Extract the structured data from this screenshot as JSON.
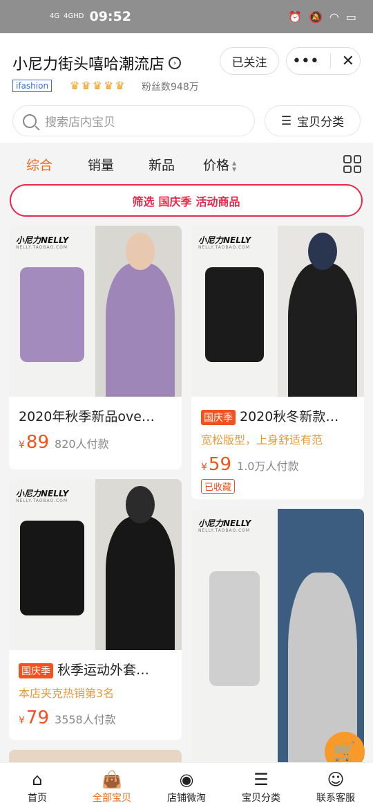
{
  "status_bar": {
    "signal1": "4G",
    "signal2": "4GHD",
    "time": "09:52"
  },
  "shop": {
    "name": "小尼力街头嘻哈潮流店",
    "follow_label": "已关注",
    "badge": "ifashion",
    "fans": "粉丝数948万",
    "crown_count": 5
  },
  "search": {
    "placeholder": "搜索店内宝贝",
    "category_label": "宝贝分类"
  },
  "sort_tabs": {
    "overall": "综合",
    "sales": "销量",
    "new": "新品",
    "price": "价格"
  },
  "filter_banner": {
    "prefix": "筛选",
    "highlight": "国庆季",
    "suffix": "活动商品"
  },
  "products": [
    {
      "brand": "小尼力NELLY",
      "brand_sub": "NELLY.TAOBAO.COM",
      "title": "2020年秋季新品ove…",
      "price": "89",
      "sold": "820人付款"
    },
    {
      "brand": "小尼力NELLY",
      "brand_sub": "NELLY.TAOBAO.COM",
      "tag": "国庆季",
      "title": "2020秋冬新款…",
      "subtitle": "宽松版型，上身舒适有范",
      "price": "59",
      "sold": "1.0万人付款",
      "fav": "已收藏"
    },
    {
      "brand": "小尼力NELLY",
      "brand_sub": "NELLY.TAOBAO.COM",
      "tag": "国庆季",
      "title": "秋季运动外套…",
      "subtitle": "本店夹克热销第3名",
      "price": "79",
      "sold": "3558人付款"
    },
    {
      "brand": "小尼力NELLY",
      "brand_sub": "NELLY.TAOBAO.COM"
    }
  ],
  "currency": "¥",
  "bottom_nav": {
    "home": "首页",
    "all": "全部宝贝",
    "weitao": "店铺微淘",
    "category": "宝贝分类",
    "service": "联系客服"
  },
  "colors": {
    "accent": "#f26a1b",
    "price": "#f2521d",
    "filter": "#e8294a"
  }
}
